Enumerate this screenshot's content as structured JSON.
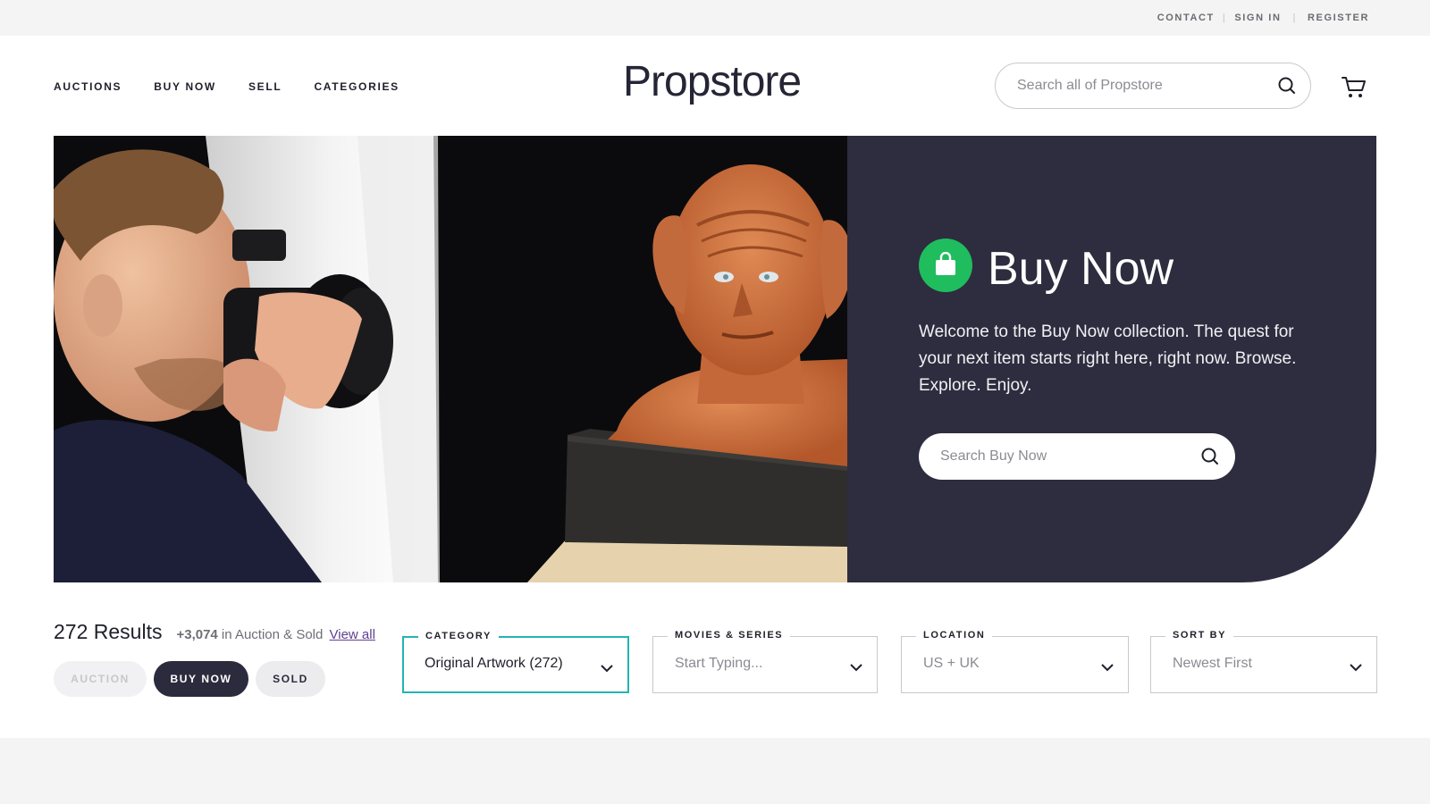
{
  "utility": {
    "contact": "CONTACT",
    "sign_in": "SIGN IN",
    "register": "REGISTER"
  },
  "nav": {
    "auctions": "AUCTIONS",
    "buy_now": "BUY NOW",
    "sell": "SELL",
    "categories": "CATEGORIES"
  },
  "logo": "Propstore",
  "site_search": {
    "placeholder": "Search all of Propstore"
  },
  "hero": {
    "title": "Buy Now",
    "text": "Welcome to the Buy Now collection. The quest for your next item starts right here, right now. Browse. Explore. Enjoy.",
    "search_placeholder": "Search Buy Now",
    "badge_color": "#1fbd5e",
    "panel_color": "#2e2c3f"
  },
  "results": {
    "count": "272 Results",
    "extra_num": "+3,074",
    "extra_text": " in Auction & Sold",
    "view_all": "View all"
  },
  "modes": {
    "auction": "AUCTION",
    "buy_now": "BUY NOW",
    "sold": "SOLD",
    "selected": "BUY NOW"
  },
  "filters": {
    "category": {
      "label": "CATEGORY",
      "value": "Original Artwork (272)"
    },
    "movies": {
      "label": "MOVIES & SERIES",
      "placeholder": "Start Typing..."
    },
    "location": {
      "label": "LOCATION",
      "value": "US + UK"
    },
    "sort": {
      "label": "SORT BY",
      "value": "Newest First"
    }
  },
  "colors": {
    "accent_teal": "#25b3b3",
    "link_purple": "#5e3f8f",
    "dark_navy": "#2c2b3d"
  }
}
